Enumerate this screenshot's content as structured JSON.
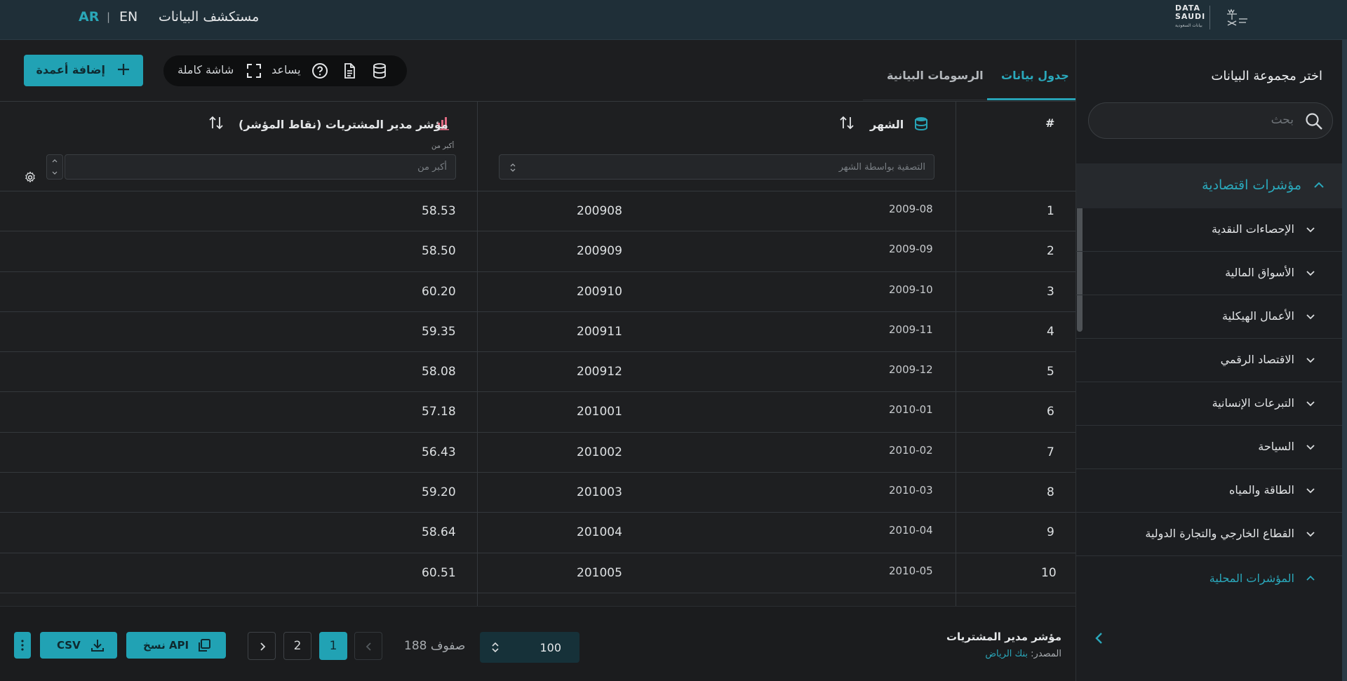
{
  "header": {
    "lang_ar": "AR",
    "lang_sep": "|",
    "lang_en": "EN",
    "app_title": "مستكشف البيانات",
    "logo_text_line1": "DATA",
    "logo_text_line2": "SAUDI",
    "logo_sub": "بيانات السعودية"
  },
  "sidebar": {
    "title": "اختر مجموعة البيانات",
    "search_placeholder": "بحث",
    "category": "مؤشرات اقتصادية",
    "items": [
      {
        "label": "الإحصاءات النقدية"
      },
      {
        "label": "الأسواق المالية"
      },
      {
        "label": "الأعمال الهيكلية"
      },
      {
        "label": "الاقتصاد الرقمي"
      },
      {
        "label": "التبرعات الإنسانية"
      },
      {
        "label": "السياحة"
      },
      {
        "label": "الطاقة والمياه"
      },
      {
        "label": "القطاع الخارجي والتجارة الدولية"
      }
    ],
    "category2": "المؤشرات المحلية"
  },
  "toolbar": {
    "add_columns": "إضافة أعمدة",
    "fullscreen": "شاشة كاملة",
    "help": "يساعد"
  },
  "tabs": {
    "data_table": "جدول بيانات",
    "charts": "الرسومات البيانية"
  },
  "table": {
    "col_index": "#",
    "col_month": "الشهر",
    "col_pmi": "مؤشر مدير المشتريات (نقاط المؤشر)",
    "month_filter_placeholder": "التصفية بواسطة الشهر",
    "pmi_filter_hint": "أكبر من",
    "pmi_filter_placeholder": "أكبر من",
    "rows": [
      {
        "idx": "1",
        "date": "2009-08",
        "month": "200908",
        "value": "58.53"
      },
      {
        "idx": "2",
        "date": "2009-09",
        "month": "200909",
        "value": "58.50"
      },
      {
        "idx": "3",
        "date": "2009-10",
        "month": "200910",
        "value": "60.20"
      },
      {
        "idx": "4",
        "date": "2009-11",
        "month": "200911",
        "value": "59.35"
      },
      {
        "idx": "5",
        "date": "2009-12",
        "month": "200912",
        "value": "58.08"
      },
      {
        "idx": "6",
        "date": "2010-01",
        "month": "201001",
        "value": "57.18"
      },
      {
        "idx": "7",
        "date": "2010-02",
        "month": "201002",
        "value": "56.43"
      },
      {
        "idx": "8",
        "date": "2010-03",
        "month": "201003",
        "value": "59.20"
      },
      {
        "idx": "9",
        "date": "2010-04",
        "month": "201004",
        "value": "58.64"
      },
      {
        "idx": "10",
        "date": "2010-05",
        "month": "201005",
        "value": "60.51"
      }
    ]
  },
  "footer": {
    "csv": "CSV",
    "copy_api": "نسخ API",
    "page_1": "1",
    "page_2": "2",
    "rows_count": "188 صفوف",
    "page_size": "100",
    "dataset_name": "مؤشر مدير المشتريات",
    "source_label": "المصدر:",
    "source_link": "بنك الرياض"
  },
  "colors": {
    "accent": "#21a2b4",
    "topbar": "#1f2f38",
    "background": "#1d1e20"
  }
}
